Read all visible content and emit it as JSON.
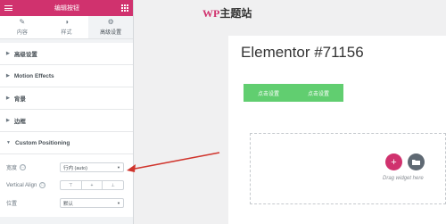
{
  "panel": {
    "title": "编辑按钮",
    "tabs": [
      {
        "label": "内容",
        "icon": "pencil-icon"
      },
      {
        "label": "样式",
        "icon": "contrast-icon"
      },
      {
        "label": "高级设置",
        "icon": "gear-icon"
      }
    ],
    "sections": [
      {
        "label": "高级设置"
      },
      {
        "label": "Motion Effects"
      },
      {
        "label": "背景"
      },
      {
        "label": "边框"
      }
    ],
    "open_section": {
      "label": "Custom Positioning",
      "controls": {
        "width": {
          "label": "宽度",
          "value": "行内 (auto)"
        },
        "valign": {
          "label": "Vertical Align"
        },
        "position": {
          "label": "位置",
          "value": "默认"
        }
      }
    }
  },
  "canvas": {
    "logo": {
      "accent": "WP",
      "rest": "主题站"
    },
    "heading": "Elementor #71156",
    "buttons": [
      "点击设置",
      "点击设置"
    ],
    "drop_hint": "Drag widget here"
  },
  "colors": {
    "brand": "#d0326e",
    "button_green": "#61ce70",
    "arrow_red": "#d0342c"
  }
}
